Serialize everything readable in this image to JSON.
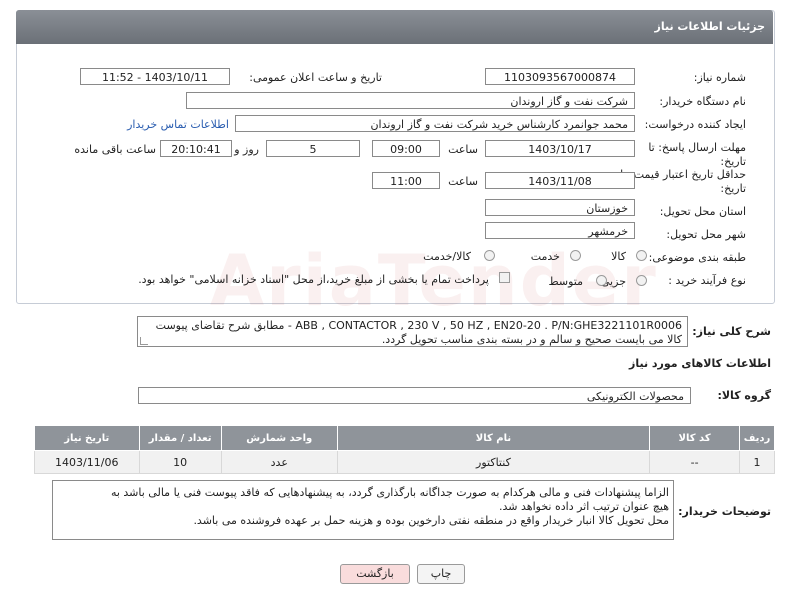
{
  "header": {
    "title": "جزئیات اطلاعات نیاز"
  },
  "form": {
    "need_number": {
      "label": "شماره نیاز:",
      "value": "1103093567000874"
    },
    "announce": {
      "label": "تاریخ و ساعت اعلان عمومی:",
      "value": "1403/10/11 - 11:52"
    },
    "buyer": {
      "label": "نام دستگاه خریدار:",
      "value": "شرکت نفت و گاز اروندان"
    },
    "requester": {
      "label": "ایجاد کننده درخواست:",
      "value": "محمد جوانمرد کارشناس خرید شرکت نفت و گاز اروندان",
      "contact_link": "اطلاعات تماس خریدار"
    },
    "deadline": {
      "label_line1": "مهلت ارسال پاسخ: تا",
      "label_line2": "تاریخ:",
      "date": "1403/10/17",
      "time_label": "ساعت",
      "time": "09:00",
      "days": "5",
      "days_label": "روز و",
      "remaining": "20:10:41",
      "remaining_label": "ساعت باقی مانده"
    },
    "validity": {
      "label_line1": "حداقل تاریخ اعتبار قیمت: تا",
      "label_line2": "تاریخ:",
      "date": "1403/11/08",
      "time_label": "ساعت",
      "time": "11:00"
    },
    "province": {
      "label": "استان محل تحویل:",
      "value": "خوزستان"
    },
    "city": {
      "label": "شهر محل تحویل:",
      "value": "خرمشهر"
    },
    "category": {
      "label": "طبقه بندی موضوعی:",
      "options": [
        "کالا",
        "خدمت",
        "کالا/خدمت"
      ]
    },
    "process": {
      "label": "نوع فرآیند خرید :",
      "options": [
        "جزیی",
        "متوسط"
      ],
      "payment_note": "پرداخت تمام یا بخشی از مبلغ خرید،از محل \"اسناد خزانه اسلامی\" خواهد بود."
    }
  },
  "description": {
    "label": "شرح کلی نیاز:",
    "line1": "ABB , CONTACTOR , 230 V , 50 HZ , EN20-20  . P/N:GHE3221101R0006  - مطابق شرح تقاضای پیوست",
    "line2": "کالا می بایست صحیح و سالم و در بسته بندی مناسب تحویل گردد."
  },
  "goods": {
    "section_title": "اطلاعات کالاهای مورد نیاز",
    "group_label": "گروه کالا:",
    "group_value": "محصولات الکترونیکی",
    "columns": [
      "ردیف",
      "کد کالا",
      "نام کالا",
      "واحد شمارش",
      "تعداد / مقدار",
      "تاریخ نیاز"
    ],
    "rows": [
      {
        "row": "1",
        "code": "--",
        "name": "کنتاکتور",
        "unit": "عدد",
        "qty": "10",
        "date": "1403/11/06"
      }
    ]
  },
  "buyer_notes": {
    "label": "توضیحات خریدار:",
    "line1": "الزاما پیشنهادات فنی و مالی هرکدام به صورت جداگانه بارگذاری گردد، به پیشنهادهایی که فاقد پیوست فنی یا مالی باشد به",
    "line2": "هیچ عنوان ترتیب اثر داده نخواهد شد.",
    "line3": "محل تحویل کالا انبار خریدار واقع در منطقه نفتی دارخوین بوده و هزینه حمل بر عهده فروشنده می باشد."
  },
  "buttons": {
    "print": "چاپ",
    "back": "بازگشت"
  },
  "colors": {
    "header": "#7a7f86",
    "back_button_bg": "#f9dcdc",
    "link": "#2a5db0"
  }
}
